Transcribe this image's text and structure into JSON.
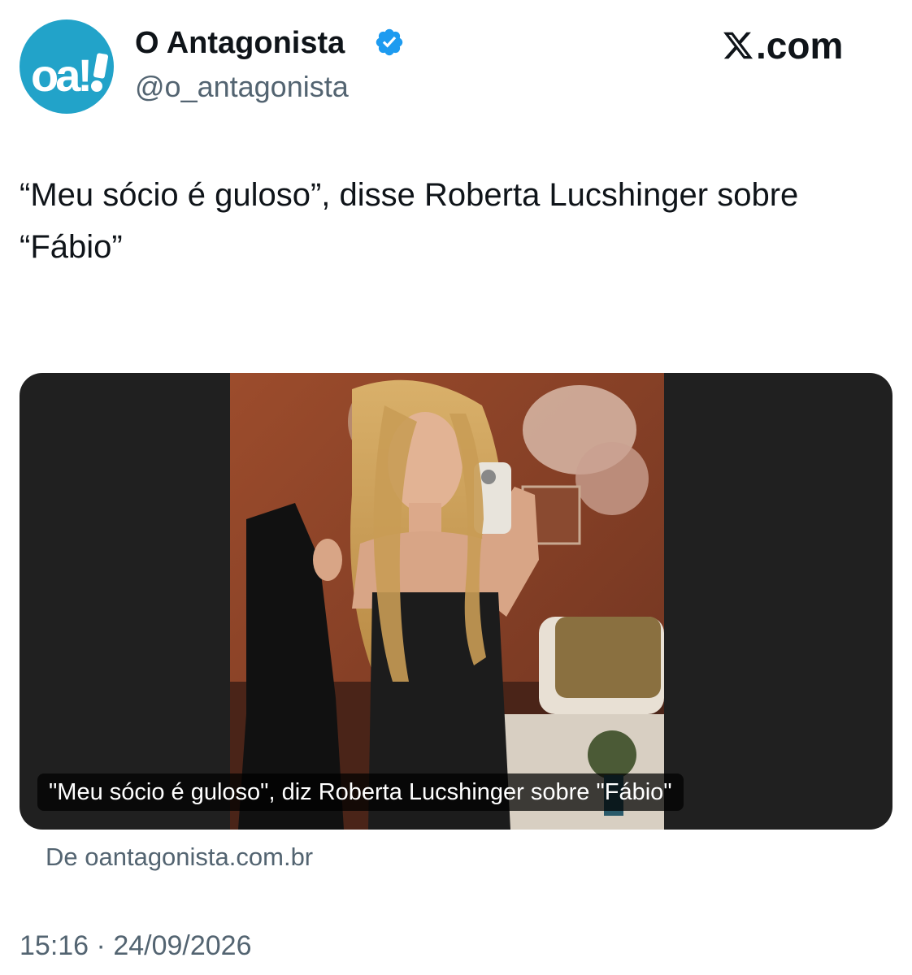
{
  "author": {
    "avatar_text": "oa!",
    "avatar_icon": "news-logo-icon",
    "display_name": "O Antagonista",
    "verified_icon": "verified-badge-icon",
    "handle": "@o_antagonista"
  },
  "brand": {
    "icon": "x-logo-icon",
    "suffix": ".com"
  },
  "tweet": {
    "text": "“Meu sócio é guloso”, disse Roberta Lucshinger sobre “Fábio”"
  },
  "card": {
    "image_icon": "article-photo",
    "title": "\"Meu sócio é guloso\", diz Roberta Lucshinger sobre \"Fábio\"",
    "source": "De oantagonista.com.br"
  },
  "meta": {
    "time": "15:16",
    "separator": "·",
    "date": "24/09/2026"
  },
  "colors": {
    "avatar_bg": "#22a3c9",
    "verified": "#1d9bf0",
    "secondary_text": "#536471",
    "card_bg": "#202020"
  }
}
